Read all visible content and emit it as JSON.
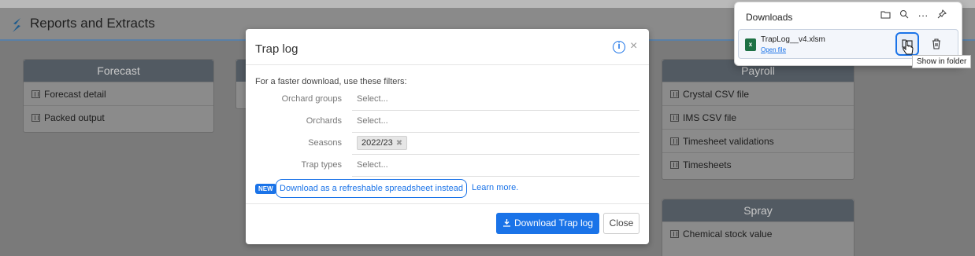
{
  "app": {
    "title": "Reports and Extracts"
  },
  "panels": {
    "forecast": {
      "title": "Forecast",
      "items": [
        "Forecast detail",
        "Packed output"
      ]
    },
    "payroll": {
      "title": "Payroll",
      "items": [
        "Crystal CSV file",
        "IMS CSV file",
        "Timesheet validations",
        "Timesheets"
      ]
    },
    "spray": {
      "title": "Spray",
      "items": [
        "Chemical stock value"
      ]
    }
  },
  "modal": {
    "title": "Trap log",
    "info_icon": "info-icon",
    "close_glyph": "×",
    "hint": "For a faster download, use these filters:",
    "filters": [
      {
        "label": "Orchard groups",
        "placeholder": "Select..."
      },
      {
        "label": "Orchards",
        "placeholder": "Select..."
      },
      {
        "label": "Seasons",
        "chip": "2022/23",
        "chip_remove": "✖"
      },
      {
        "label": "Trap types",
        "placeholder": "Select..."
      }
    ],
    "new_badge": "NEW",
    "download_spreadsheet_link": "Download as a refreshable spreadsheet instead",
    "learn_more": "Learn more.",
    "download_button": "Download Trap log",
    "close_button": "Close"
  },
  "downloads": {
    "title": "Downloads",
    "toolbar": [
      "folder-icon",
      "search-icon",
      "more-icon",
      "pin-icon"
    ],
    "item": {
      "filename": "TrapLog__v4.xlsm",
      "open_link": "Open file"
    },
    "tooltip": "Show in folder"
  },
  "colors": {
    "accent": "#1a73e8",
    "panel_header": "#525a62",
    "excel_green": "#1e7145"
  }
}
